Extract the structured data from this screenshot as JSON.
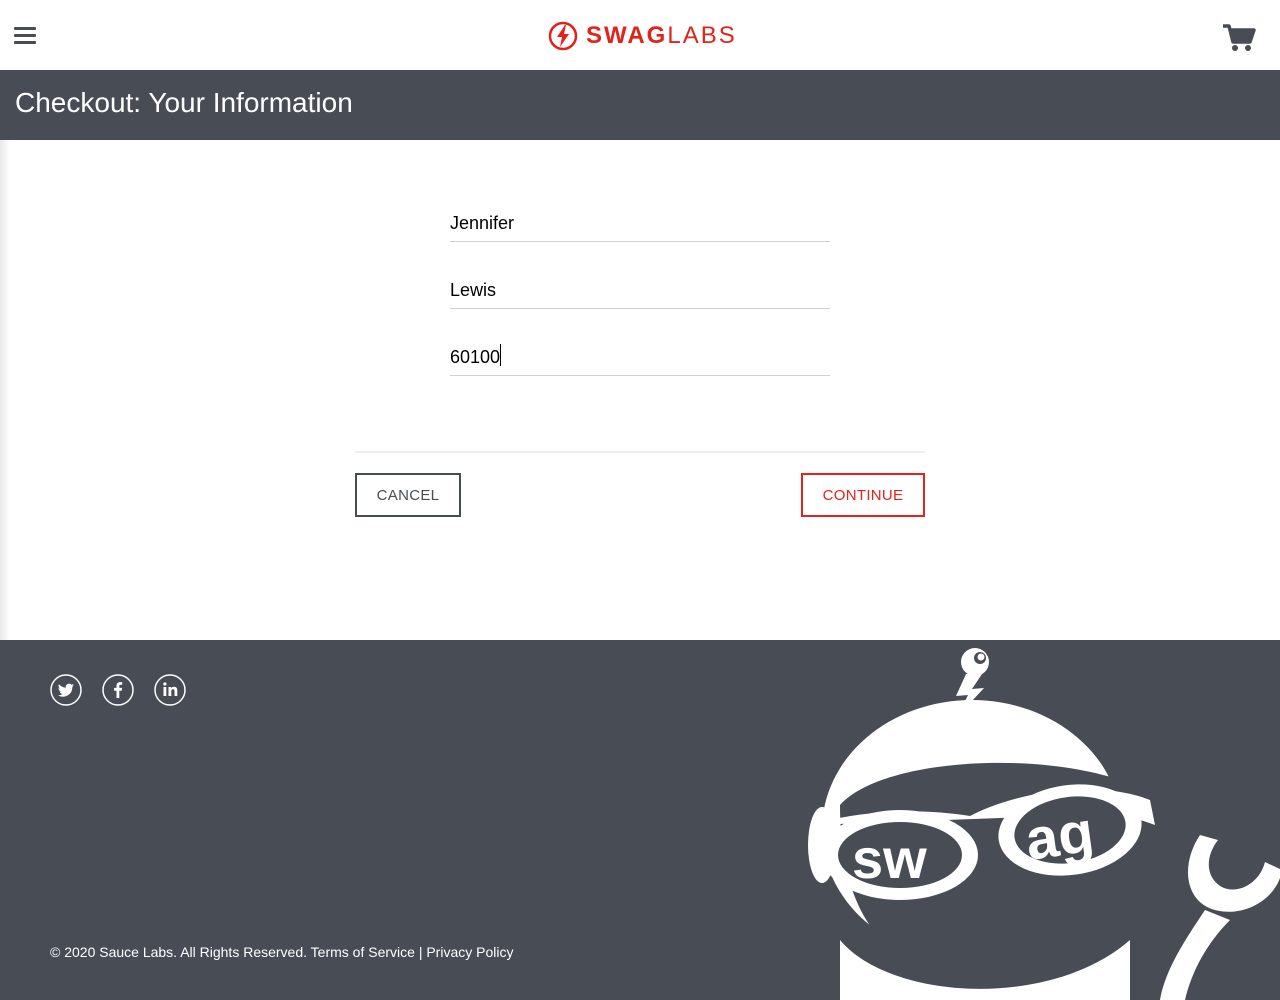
{
  "header": {
    "brand_bold": "SWAG",
    "brand_light": "LABS",
    "menu_icon": "hamburger-menu-icon",
    "cart_icon": "shopping-cart-icon"
  },
  "subheader": {
    "title": "Checkout: Your Information"
  },
  "form": {
    "first_name": "Jennifer",
    "last_name": "Lewis",
    "postal_code": "60100"
  },
  "actions": {
    "cancel_label": "CANCEL",
    "continue_label": "CONTINUE"
  },
  "footer": {
    "social": [
      "twitter-icon",
      "facebook-icon",
      "linkedin-icon"
    ],
    "copyright": "© 2020 Sauce Labs. All Rights Reserved.",
    "terms_link": "Terms of Service",
    "separator": "|",
    "privacy_link": "Privacy Policy",
    "robot_glasses_left": "sw",
    "robot_glasses_right": "ag"
  },
  "colors": {
    "brand_red": "#e2231a",
    "dark_gray": "#474c55"
  }
}
